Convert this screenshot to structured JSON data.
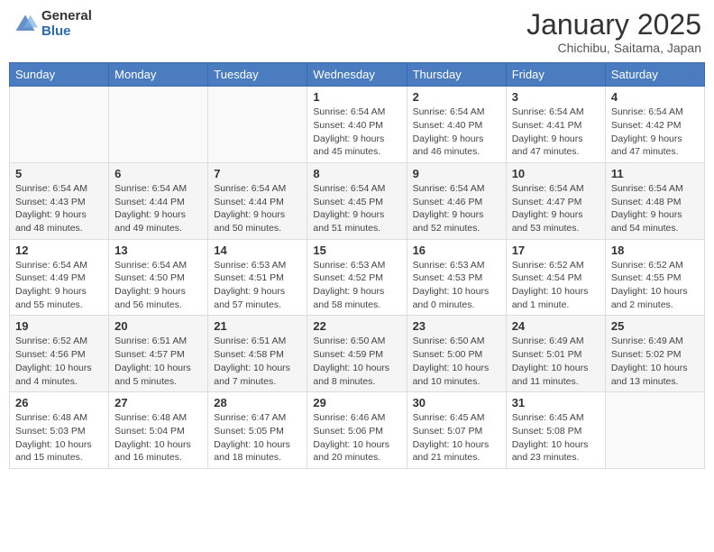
{
  "header": {
    "logo_general": "General",
    "logo_blue": "Blue",
    "month": "January 2025",
    "location": "Chichibu, Saitama, Japan"
  },
  "weekdays": [
    "Sunday",
    "Monday",
    "Tuesday",
    "Wednesday",
    "Thursday",
    "Friday",
    "Saturday"
  ],
  "weeks": [
    [
      {
        "day": "",
        "info": ""
      },
      {
        "day": "",
        "info": ""
      },
      {
        "day": "",
        "info": ""
      },
      {
        "day": "1",
        "info": "Sunrise: 6:54 AM\nSunset: 4:40 PM\nDaylight: 9 hours\nand 45 minutes."
      },
      {
        "day": "2",
        "info": "Sunrise: 6:54 AM\nSunset: 4:40 PM\nDaylight: 9 hours\nand 46 minutes."
      },
      {
        "day": "3",
        "info": "Sunrise: 6:54 AM\nSunset: 4:41 PM\nDaylight: 9 hours\nand 47 minutes."
      },
      {
        "day": "4",
        "info": "Sunrise: 6:54 AM\nSunset: 4:42 PM\nDaylight: 9 hours\nand 47 minutes."
      }
    ],
    [
      {
        "day": "5",
        "info": "Sunrise: 6:54 AM\nSunset: 4:43 PM\nDaylight: 9 hours\nand 48 minutes."
      },
      {
        "day": "6",
        "info": "Sunrise: 6:54 AM\nSunset: 4:44 PM\nDaylight: 9 hours\nand 49 minutes."
      },
      {
        "day": "7",
        "info": "Sunrise: 6:54 AM\nSunset: 4:44 PM\nDaylight: 9 hours\nand 50 minutes."
      },
      {
        "day": "8",
        "info": "Sunrise: 6:54 AM\nSunset: 4:45 PM\nDaylight: 9 hours\nand 51 minutes."
      },
      {
        "day": "9",
        "info": "Sunrise: 6:54 AM\nSunset: 4:46 PM\nDaylight: 9 hours\nand 52 minutes."
      },
      {
        "day": "10",
        "info": "Sunrise: 6:54 AM\nSunset: 4:47 PM\nDaylight: 9 hours\nand 53 minutes."
      },
      {
        "day": "11",
        "info": "Sunrise: 6:54 AM\nSunset: 4:48 PM\nDaylight: 9 hours\nand 54 minutes."
      }
    ],
    [
      {
        "day": "12",
        "info": "Sunrise: 6:54 AM\nSunset: 4:49 PM\nDaylight: 9 hours\nand 55 minutes."
      },
      {
        "day": "13",
        "info": "Sunrise: 6:54 AM\nSunset: 4:50 PM\nDaylight: 9 hours\nand 56 minutes."
      },
      {
        "day": "14",
        "info": "Sunrise: 6:53 AM\nSunset: 4:51 PM\nDaylight: 9 hours\nand 57 minutes."
      },
      {
        "day": "15",
        "info": "Sunrise: 6:53 AM\nSunset: 4:52 PM\nDaylight: 9 hours\nand 58 minutes."
      },
      {
        "day": "16",
        "info": "Sunrise: 6:53 AM\nSunset: 4:53 PM\nDaylight: 10 hours\nand 0 minutes."
      },
      {
        "day": "17",
        "info": "Sunrise: 6:52 AM\nSunset: 4:54 PM\nDaylight: 10 hours\nand 1 minute."
      },
      {
        "day": "18",
        "info": "Sunrise: 6:52 AM\nSunset: 4:55 PM\nDaylight: 10 hours\nand 2 minutes."
      }
    ],
    [
      {
        "day": "19",
        "info": "Sunrise: 6:52 AM\nSunset: 4:56 PM\nDaylight: 10 hours\nand 4 minutes."
      },
      {
        "day": "20",
        "info": "Sunrise: 6:51 AM\nSunset: 4:57 PM\nDaylight: 10 hours\nand 5 minutes."
      },
      {
        "day": "21",
        "info": "Sunrise: 6:51 AM\nSunset: 4:58 PM\nDaylight: 10 hours\nand 7 minutes."
      },
      {
        "day": "22",
        "info": "Sunrise: 6:50 AM\nSunset: 4:59 PM\nDaylight: 10 hours\nand 8 minutes."
      },
      {
        "day": "23",
        "info": "Sunrise: 6:50 AM\nSunset: 5:00 PM\nDaylight: 10 hours\nand 10 minutes."
      },
      {
        "day": "24",
        "info": "Sunrise: 6:49 AM\nSunset: 5:01 PM\nDaylight: 10 hours\nand 11 minutes."
      },
      {
        "day": "25",
        "info": "Sunrise: 6:49 AM\nSunset: 5:02 PM\nDaylight: 10 hours\nand 13 minutes."
      }
    ],
    [
      {
        "day": "26",
        "info": "Sunrise: 6:48 AM\nSunset: 5:03 PM\nDaylight: 10 hours\nand 15 minutes."
      },
      {
        "day": "27",
        "info": "Sunrise: 6:48 AM\nSunset: 5:04 PM\nDaylight: 10 hours\nand 16 minutes."
      },
      {
        "day": "28",
        "info": "Sunrise: 6:47 AM\nSunset: 5:05 PM\nDaylight: 10 hours\nand 18 minutes."
      },
      {
        "day": "29",
        "info": "Sunrise: 6:46 AM\nSunset: 5:06 PM\nDaylight: 10 hours\nand 20 minutes."
      },
      {
        "day": "30",
        "info": "Sunrise: 6:45 AM\nSunset: 5:07 PM\nDaylight: 10 hours\nand 21 minutes."
      },
      {
        "day": "31",
        "info": "Sunrise: 6:45 AM\nSunset: 5:08 PM\nDaylight: 10 hours\nand 23 minutes."
      },
      {
        "day": "",
        "info": ""
      }
    ]
  ]
}
